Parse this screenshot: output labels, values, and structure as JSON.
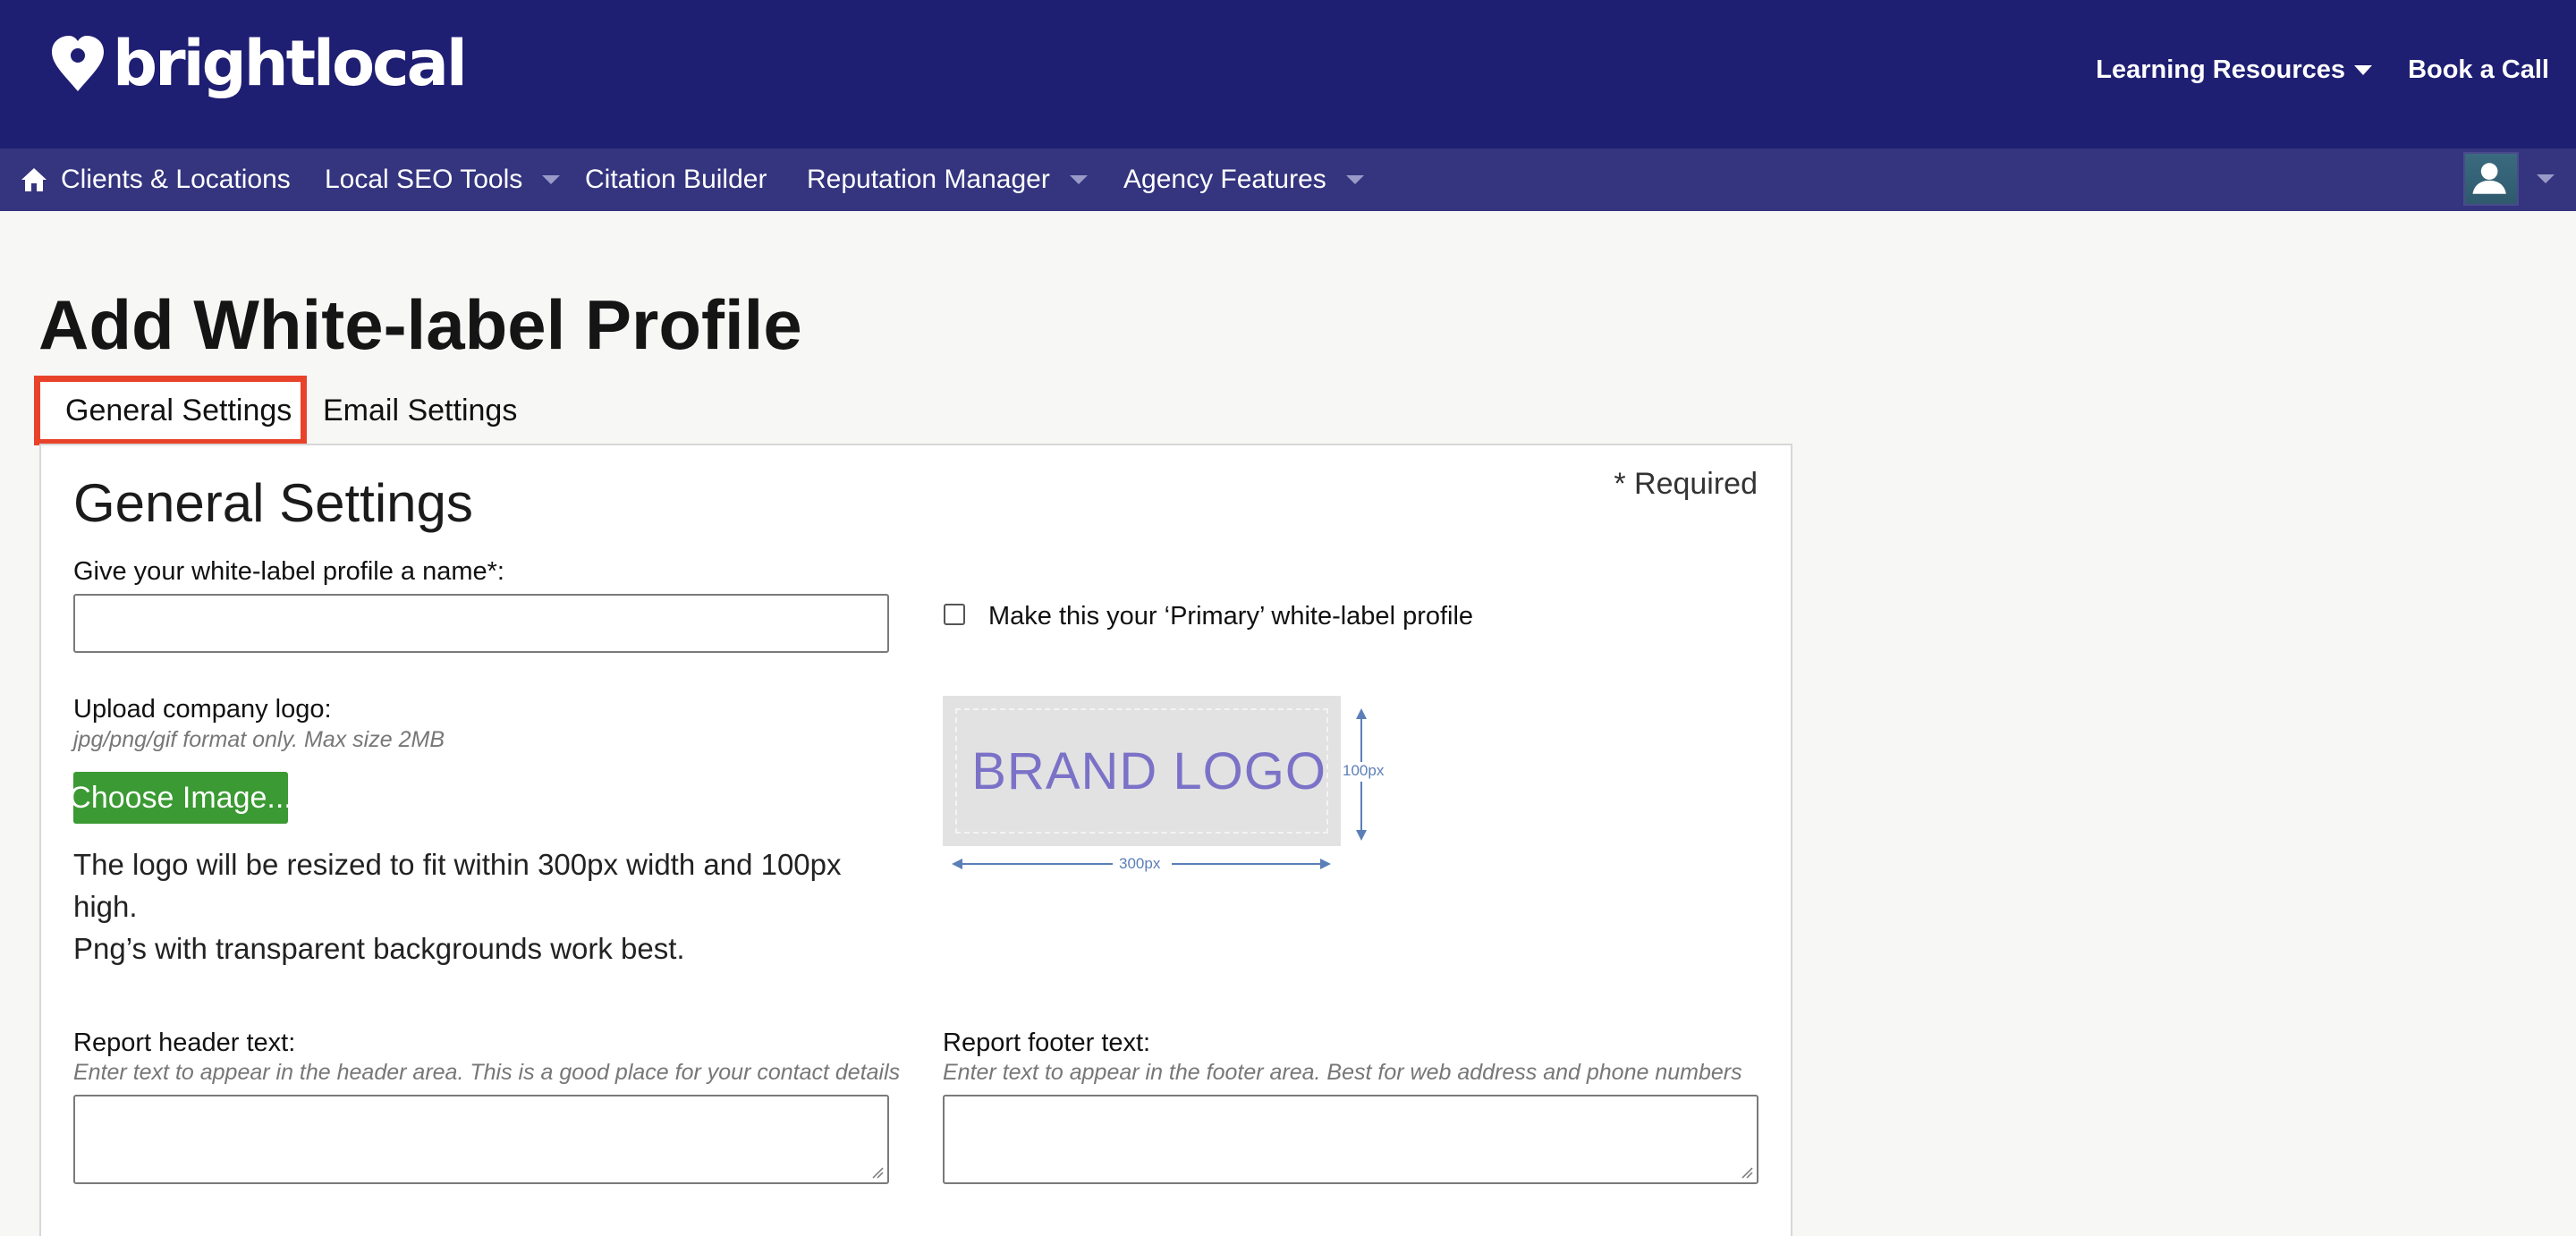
{
  "brand": {
    "name": "brightlocal"
  },
  "header": {
    "links": [
      {
        "label": "Learning Resources",
        "has_dropdown": true
      },
      {
        "label": "Book a Call",
        "has_dropdown": false
      }
    ]
  },
  "nav": {
    "items": [
      {
        "label": "Clients & Locations",
        "icon": "home-icon",
        "has_dropdown": false
      },
      {
        "label": "Local SEO Tools",
        "has_dropdown": true
      },
      {
        "label": "Citation Builder",
        "has_dropdown": false
      },
      {
        "label": "Reputation Manager",
        "has_dropdown": true
      },
      {
        "label": "Agency Features",
        "has_dropdown": true
      }
    ],
    "user_icon": "user-avatar-icon"
  },
  "page": {
    "title": "Add White-label Profile",
    "tabs": [
      {
        "label": "General Settings",
        "active": true
      },
      {
        "label": "Email Settings",
        "active": false
      }
    ]
  },
  "form": {
    "section_title": "General Settings",
    "required_note": "* Required",
    "name_label": "Give your white-label profile a name*:",
    "name_value": "",
    "primary_label": "Make this your ‘Primary’ white-label profile",
    "primary_checked": false,
    "logo_label": "Upload company logo:",
    "logo_hint": "jpg/png/gif format only. Max size 2MB",
    "choose_button": "Choose Image...",
    "resize_note_1": "The logo will be resized to fit within 300px width and 100px high.",
    "resize_note_2": "Png’s with transparent backgrounds work best.",
    "preview": {
      "text": "BRAND LOGO",
      "width_label": "300px",
      "height_label": "100px"
    },
    "header_label": "Report header text:",
    "header_hint": "Enter text to appear in the header area. This is a good place for your contact details",
    "header_value": "",
    "footer_label": "Report footer text:",
    "footer_hint": "Enter text to appear in the footer area. Best for web address and phone numbers",
    "footer_value": ""
  },
  "colors": {
    "header_bg": "#1e1e73",
    "nav_bg": "#34347f",
    "button_green": "#3b9a33",
    "highlight_red": "#e8432a"
  }
}
